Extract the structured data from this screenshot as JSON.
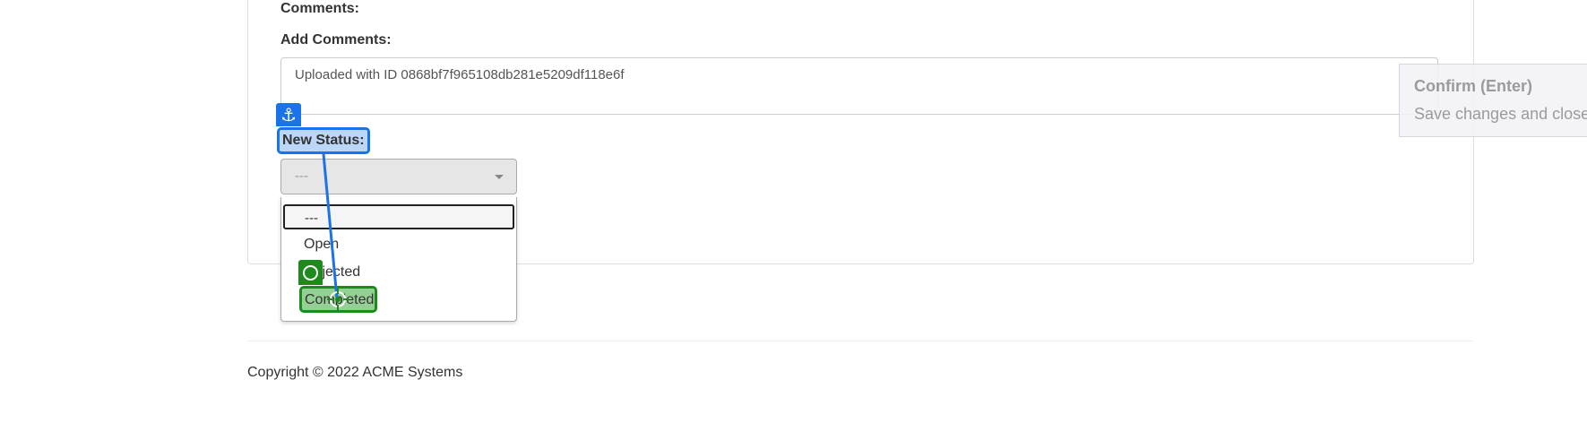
{
  "form": {
    "comments_heading": "Comments:",
    "add_comments_label": "Add Comments:",
    "comment_value": "Uploaded with ID 0868bf7f965108db281e5209df118e6f",
    "new_status_label": "New Status:",
    "status_select": {
      "selected": "---",
      "search_value": "---",
      "options": [
        "Open",
        "Rejected",
        "Completed"
      ]
    }
  },
  "annotations": {
    "anchor_icon": "⚓",
    "anchor_color": "#1a73e8",
    "target_color": "#1e8a1e"
  },
  "tooltip": {
    "title": "Confirm (Enter)",
    "description": "Save changes and close"
  },
  "footer": {
    "copyright": "Copyright © 2022 ACME Systems"
  }
}
